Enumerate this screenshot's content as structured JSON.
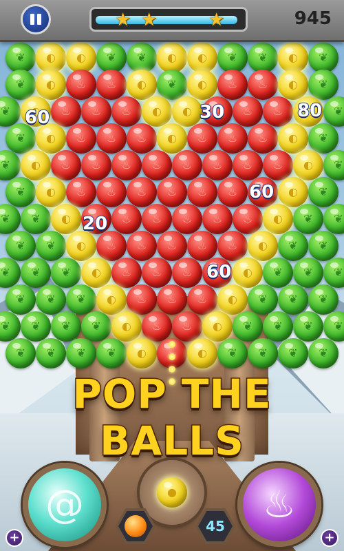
{
  "hud": {
    "score": "945",
    "stars_earned": 3,
    "progress_fraction": 0.97
  },
  "popups": [
    "60",
    "30",
    "80",
    "60",
    "20",
    "60"
  ],
  "banner_text": "POP THE BALLS",
  "shots_remaining": "45",
  "next_ball_color": "orange",
  "current_ball_color": "yellow",
  "powerups": {
    "left": "swirl-icon",
    "right": "fire-icon"
  },
  "colors": {
    "green": "#3db82a",
    "yellow": "#f3d21a",
    "red": "#e0221c",
    "banner": "#ffd21f"
  },
  "board": {
    "rows": [
      "GYYGGYYGGYG",
      "GYRRYGYRRYG",
      "GYRRRYYRRRYG",
      "GYRRRYRRRYG",
      "GYRRRRRRRRYG",
      "GYRRRRRRRYG",
      "GGYRRRRRRYGG",
      "GGYRRRRRYGG",
      "GGGYRRRRYGGG",
      "GGGYRRRYGGG",
      "GGGGYRRYGGGG",
      "GGGGYRYGGGG"
    ]
  }
}
